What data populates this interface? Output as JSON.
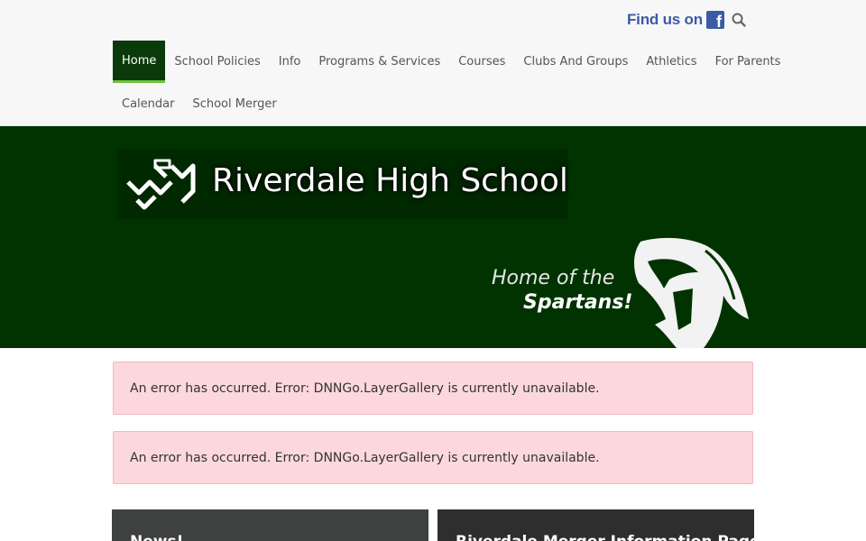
{
  "header": {
    "find_us_text": "Find us on",
    "facebook_letter": "f"
  },
  "nav": {
    "row1": [
      {
        "label": "Home",
        "active": true
      },
      {
        "label": "School Policies"
      },
      {
        "label": "Info"
      },
      {
        "label": "Programs & Services"
      },
      {
        "label": "Courses"
      },
      {
        "label": "Clubs And Groups"
      },
      {
        "label": "Athletics"
      },
      {
        "label": "For Parents"
      }
    ],
    "row2": [
      {
        "label": "Calendar"
      },
      {
        "label": "School Merger"
      }
    ]
  },
  "banner": {
    "school_name": "Riverdale High School",
    "tagline_line1": "Home of the",
    "tagline_line2": "Spartans!"
  },
  "alerts": [
    "An error has occurred. Error: DNNGo.LayerGallery is currently unavailable.",
    "An error has occurred. Error: DNNGo.LayerGallery is currently unavailable."
  ],
  "cards": [
    {
      "title": "News!"
    },
    {
      "title": "Riverdale Merger Information Page"
    }
  ],
  "colors": {
    "brand_green": "#003300",
    "active_nav": "#0a3a0a",
    "active_underline": "#6fbf3f",
    "facebook_blue": "#3b5ba6",
    "alert_bg": "#fcd8dd"
  }
}
